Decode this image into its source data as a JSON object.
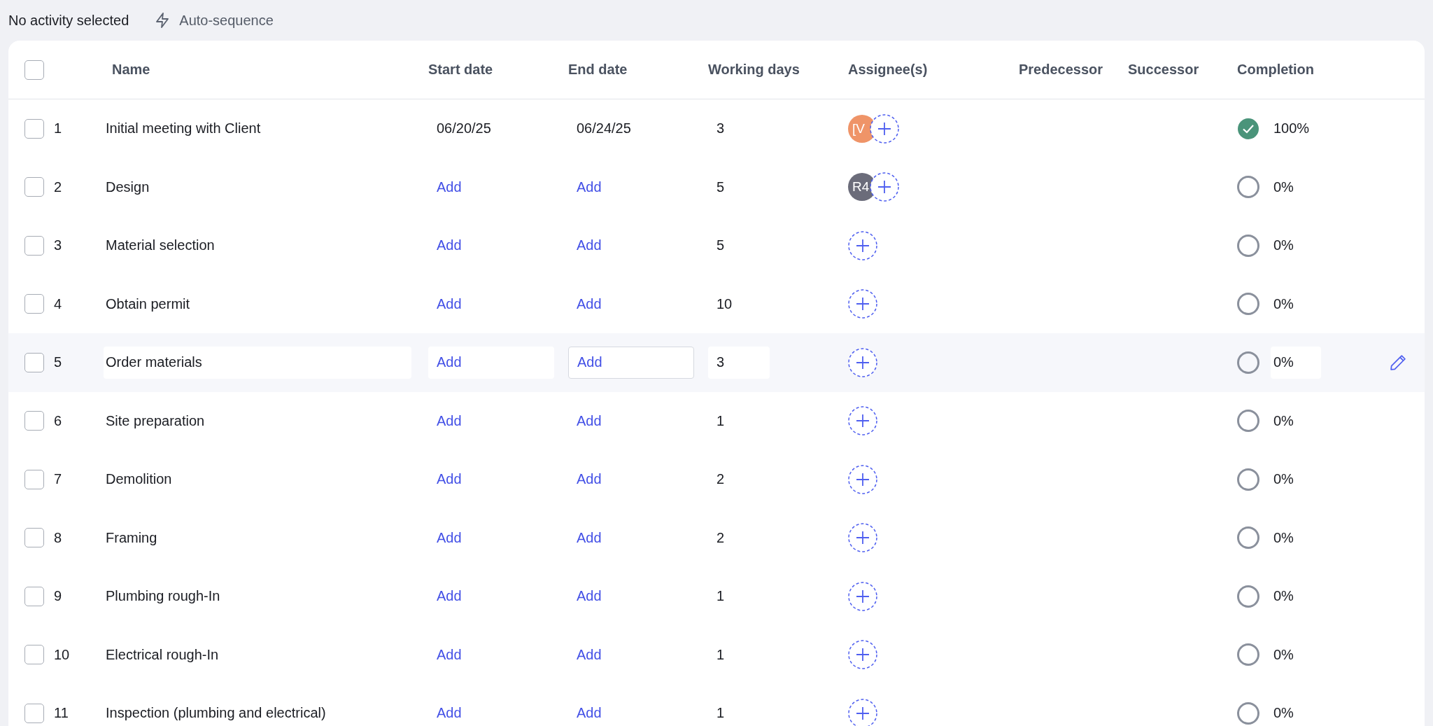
{
  "toolbar": {
    "status": "No activity selected",
    "auto_sequence": "Auto-sequence"
  },
  "table": {
    "select_all_checked": false,
    "columns": [
      "Name",
      "Start date",
      "End date",
      "Working days",
      "Assignee(s)",
      "Predecessor",
      "Successor",
      "Completion"
    ],
    "rows": [
      {
        "number": "1",
        "name": "Initial meeting with Client",
        "start": {
          "kind": "date",
          "text": "06/20/25"
        },
        "end": {
          "kind": "date",
          "text": "06/24/25"
        },
        "days": "3",
        "assignees": [
          {
            "initials": "[V",
            "color": "#ef9468"
          }
        ],
        "done": true,
        "completion": "100%",
        "checked": false,
        "editing": false
      },
      {
        "number": "2",
        "name": "Design",
        "start": {
          "kind": "add",
          "text": "Add"
        },
        "end": {
          "kind": "add",
          "text": "Add"
        },
        "days": "5",
        "assignees": [
          {
            "initials": "R4",
            "color": "#6b6c7a"
          }
        ],
        "done": false,
        "completion": "0%",
        "checked": false,
        "editing": false
      },
      {
        "number": "3",
        "name": "Material selection",
        "start": {
          "kind": "add",
          "text": "Add"
        },
        "end": {
          "kind": "add",
          "text": "Add"
        },
        "days": "5",
        "assignees": [],
        "done": false,
        "completion": "0%",
        "checked": false,
        "editing": false
      },
      {
        "number": "4",
        "name": "Obtain permit",
        "start": {
          "kind": "add",
          "text": "Add"
        },
        "end": {
          "kind": "add",
          "text": "Add"
        },
        "days": "10",
        "assignees": [],
        "done": false,
        "completion": "0%",
        "checked": false,
        "editing": false
      },
      {
        "number": "5",
        "name": "Order materials",
        "start": {
          "kind": "add",
          "text": "Add"
        },
        "end": {
          "kind": "add",
          "text": "Add"
        },
        "days": "3",
        "assignees": [],
        "done": false,
        "completion": "0%",
        "checked": false,
        "editing": true
      },
      {
        "number": "6",
        "name": "Site preparation",
        "start": {
          "kind": "add",
          "text": "Add"
        },
        "end": {
          "kind": "add",
          "text": "Add"
        },
        "days": "1",
        "assignees": [],
        "done": false,
        "completion": "0%",
        "checked": false,
        "editing": false
      },
      {
        "number": "7",
        "name": "Demolition",
        "start": {
          "kind": "add",
          "text": "Add"
        },
        "end": {
          "kind": "add",
          "text": "Add"
        },
        "days": "2",
        "assignees": [],
        "done": false,
        "completion": "0%",
        "checked": false,
        "editing": false
      },
      {
        "number": "8",
        "name": "Framing",
        "start": {
          "kind": "add",
          "text": "Add"
        },
        "end": {
          "kind": "add",
          "text": "Add"
        },
        "days": "2",
        "assignees": [],
        "done": false,
        "completion": "0%",
        "checked": false,
        "editing": false
      },
      {
        "number": "9",
        "name": "Plumbing rough-In",
        "start": {
          "kind": "add",
          "text": "Add"
        },
        "end": {
          "kind": "add",
          "text": "Add"
        },
        "days": "1",
        "assignees": [],
        "done": false,
        "completion": "0%",
        "checked": false,
        "editing": false
      },
      {
        "number": "10",
        "name": "Electrical rough-In",
        "start": {
          "kind": "add",
          "text": "Add"
        },
        "end": {
          "kind": "add",
          "text": "Add"
        },
        "days": "1",
        "assignees": [],
        "done": false,
        "completion": "0%",
        "checked": false,
        "editing": false
      },
      {
        "number": "11",
        "name": "Inspection (plumbing and electrical)",
        "start": {
          "kind": "add",
          "text": "Add"
        },
        "end": {
          "kind": "add",
          "text": "Add"
        },
        "days": "1",
        "assignees": [],
        "done": false,
        "completion": "0%",
        "checked": false,
        "editing": false
      }
    ]
  }
}
